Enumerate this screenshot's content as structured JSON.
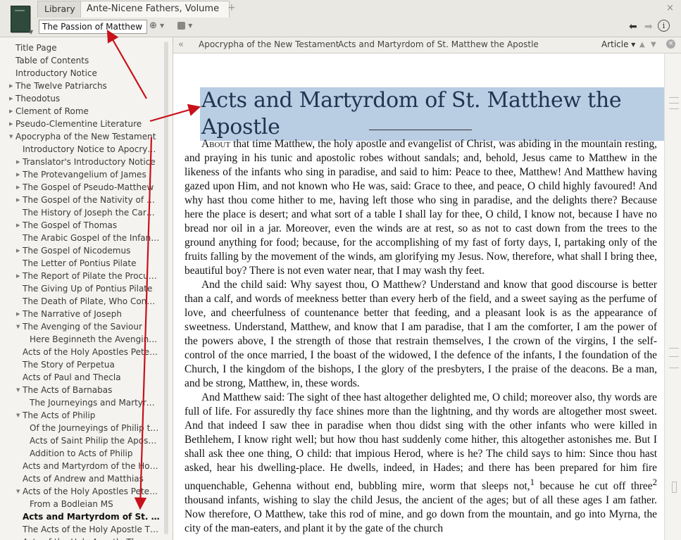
{
  "tabs": {
    "library": "Library",
    "active": "Ante-Nicene Fathers, Volume VIII",
    "plus": "+",
    "close": "×"
  },
  "toolbar": {
    "search_value": "The Passion of Matthew",
    "sync_icon": "sync-circle-icon",
    "panel_icon": "panel-layout-icon",
    "back": "⬅",
    "forward": "➡",
    "info": "i"
  },
  "sidebar": {
    "items": [
      {
        "label": "Title Page",
        "level": 0,
        "expander": ""
      },
      {
        "label": "Table of Contents",
        "level": 0,
        "expander": ""
      },
      {
        "label": "Introductory Notice",
        "level": 0,
        "expander": ""
      },
      {
        "label": "The Twelve Patriarchs",
        "level": 0,
        "expander": "▶"
      },
      {
        "label": "Theodotus",
        "level": 0,
        "expander": "▶"
      },
      {
        "label": "Clement of Rome",
        "level": 0,
        "expander": "▶"
      },
      {
        "label": "Pseudo-Clementine Literature",
        "level": 0,
        "expander": "▶"
      },
      {
        "label": "Apocrypha of the New Testament",
        "level": 0,
        "expander": "▼"
      },
      {
        "label": "Introductory Notice to Apocryph…",
        "level": 1,
        "expander": ""
      },
      {
        "label": "Translator's Introductory Notice",
        "level": 1,
        "expander": "▶"
      },
      {
        "label": "The Protevangelium of James",
        "level": 1,
        "expander": "▶"
      },
      {
        "label": "The Gospel of Pseudo-Matthew",
        "level": 1,
        "expander": "▶"
      },
      {
        "label": "The Gospel of the Nativity of Mary",
        "level": 1,
        "expander": "▶"
      },
      {
        "label": "The History of Joseph the Carpen…",
        "level": 1,
        "expander": ""
      },
      {
        "label": "The Gospel of Thomas",
        "level": 1,
        "expander": "▶"
      },
      {
        "label": "The Arabic Gospel of the Infancy…",
        "level": 1,
        "expander": ""
      },
      {
        "label": "The Gospel of Nicodemus",
        "level": 1,
        "expander": "▶"
      },
      {
        "label": "The Letter of Pontius Pilate",
        "level": 1,
        "expander": ""
      },
      {
        "label": "The Report of Pilate the Procurator",
        "level": 1,
        "expander": "▶"
      },
      {
        "label": "The Giving Up of Pontius Pilate",
        "level": 1,
        "expander": ""
      },
      {
        "label": "The Death of Pilate, Who Conde…",
        "level": 1,
        "expander": ""
      },
      {
        "label": "The Narrative of Joseph",
        "level": 1,
        "expander": "▶"
      },
      {
        "label": "The Avenging of the Saviour",
        "level": 1,
        "expander": "▼"
      },
      {
        "label": "Here Beginneth the Avenging of…",
        "level": 2,
        "expander": ""
      },
      {
        "label": "Acts of the Holy Apostles Peter a…",
        "level": 1,
        "expander": ""
      },
      {
        "label": "The Story of Perpetua",
        "level": 1,
        "expander": ""
      },
      {
        "label": "Acts of Paul and Thecla",
        "level": 1,
        "expander": ""
      },
      {
        "label": "The Acts of Barnabas",
        "level": 1,
        "expander": "▼"
      },
      {
        "label": "The Journeyings and Martyrdo…",
        "level": 2,
        "expander": ""
      },
      {
        "label": "The Acts of Philip",
        "level": 1,
        "expander": "▼"
      },
      {
        "label": "Of the Journeyings of Philip the…",
        "level": 2,
        "expander": ""
      },
      {
        "label": "Acts of Saint Philip the Aposte…",
        "level": 2,
        "expander": ""
      },
      {
        "label": "Addition to Acts of Philip",
        "level": 2,
        "expander": ""
      },
      {
        "label": "Acts and Martyrdom of the Holy…",
        "level": 1,
        "expander": ""
      },
      {
        "label": "Acts of Andrew and Matthias",
        "level": 1,
        "expander": ""
      },
      {
        "label": "Acts of the Holy Apostles Peter a…",
        "level": 1,
        "expander": "▼"
      },
      {
        "label": "From a Bodleian MS",
        "level": 2,
        "expander": ""
      },
      {
        "label": "Acts and Martyrdom of St. Matt…",
        "level": 1,
        "expander": "",
        "bold": true
      },
      {
        "label": "The Acts of the Holy Apostle Thomas",
        "level": 1,
        "expander": ""
      },
      {
        "label": "Acts of the Holy Apostle Tha…",
        "level": 1,
        "expander": ""
      }
    ]
  },
  "pathbar": {
    "collapse": "«",
    "crumb1": "Apocrypha of the New Testament",
    "separator": "›",
    "crumb2": "Acts and Martyrdom of St. Matthew the Apostle",
    "article_select": "Article ▾",
    "up": "▲",
    "down": "▼",
    "close": "×"
  },
  "article": {
    "title": "Acts and Martyrdom of St. Matthew the Apostle",
    "first_word": "About",
    "p1_rest": " that time Matthew, the holy apostle and evangelist of Christ, was abiding in the mountain resting, and praying in his tunic and apostolic robes without sandals; and, behold, Jesus came to Matthew in the likeness of the infants who sing in paradise, and said to him: Peace to thee, Matthew! And Matthew having gazed upon Him, and not known who He was, said: Grace to thee, and peace, O child highly favoured! And why hast thou come hither to me, having left those who sing in paradise, and the delights there? Because here the place is desert; and what sort of a table I shall lay for thee, O child, I know not, because I have no bread nor oil in a jar. Moreover, even the winds are at rest, so as not to cast down from the trees to the ground anything for food; because, for the accomplishing of my fast of forty days, I, partaking only of the fruits falling by the movement of the winds, am glorifying my Jesus. Now, therefore, what shall I bring thee, beautiful boy? There is not even water near, that I may wash thy feet.",
    "p2": "And the child said: Why sayest thou, O Matthew? Understand and know that good discourse is better than a calf, and words of meekness better than every herb of the field, and a sweet saying as the perfume of love, and cheerfulness of countenance better that feeding, and a pleasant look is as the appearance of sweetness. Understand, Matthew, and know that I am paradise, that I am the comforter, I am the power of the powers above, I the strength of those that restrain themselves, I the crown of the virgins, I the self-control of the once married, I the boast of the widowed, I the defence of the infants, I the foundation of the Church, I the kingdom of the bishops, I the glory of the presbyters, I the praise of the deacons. Be a man, and be strong, Matthew, in, these words.",
    "p3a": "And Matthew said: The sight of thee hast altogether delighted me, O child; moreover also, thy words are full of life. For assuredly thy face shines more than the lightning, and thy words are altogether most sweet. And that indeed I saw thee in paradise when thou didst sing with the other infants who were killed in Bethlehem, I know right well; but how thou hast suddenly come hither, this altogether astonishes me. But I shall ask thee one thing, O child: that impious Herod, where is he? The child says to him: Since thou hast asked, hear his dwelling-place. He dwells, indeed, in Hades; and there has been prepared for him fire unquenchable, Gehenna without end, bubbling mire, worm that sleeps not,",
    "fn1": "1",
    "p3b": " because he cut off three",
    "fn2": "2",
    "p3c": " thousand infants, wishing to slay the child Jesus, the ancient of the ages; but of all these ages I am father. Now therefore, O Matthew, take this rod of mine, and go down from the mountain, and go into Myrna, the city of the man-eaters, and plant it by the gate of the church"
  },
  "annotation": {
    "arrow_color": "#c8111b"
  }
}
